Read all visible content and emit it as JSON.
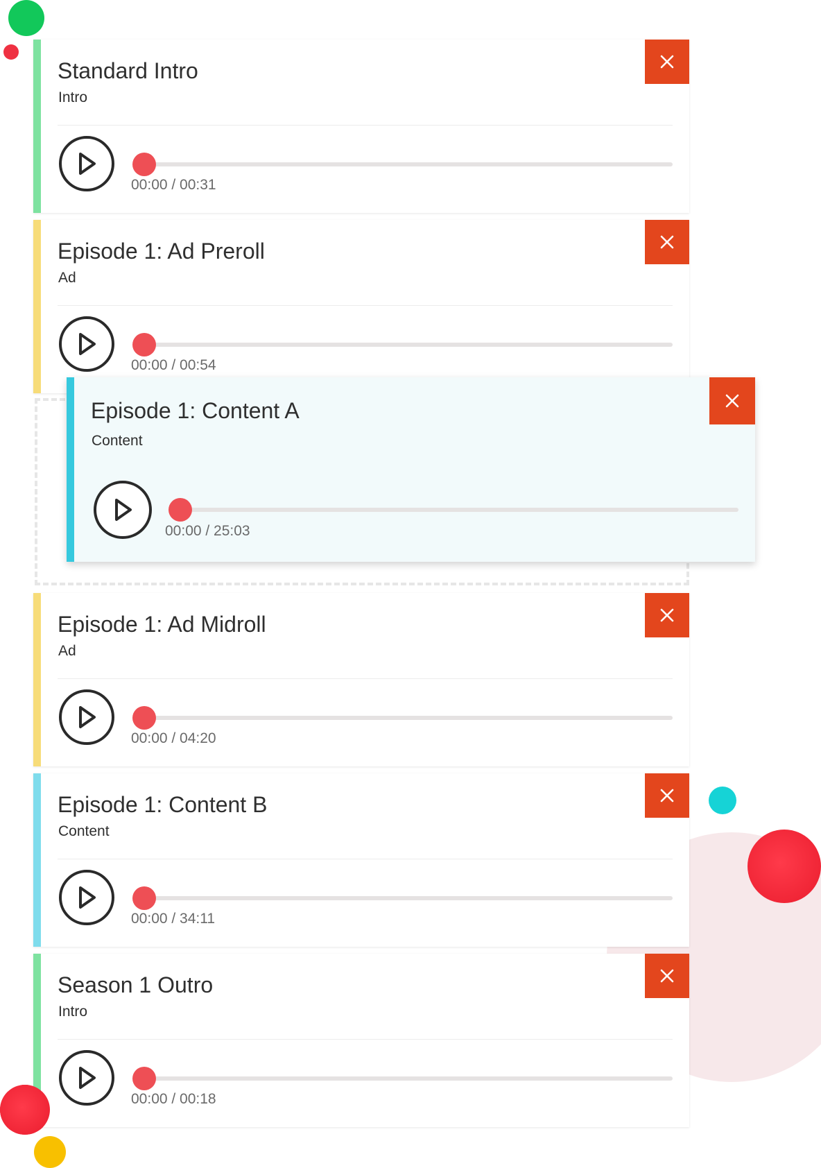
{
  "colors": {
    "intro": "#7ee2a0",
    "ad": "#f7dc79",
    "content": "#7fdcec",
    "close_button": "#e3461d",
    "progress_thumb": "#ee4f55"
  },
  "icons": {
    "close": "close-icon",
    "play": "play-icon"
  },
  "cards": [
    {
      "title": "Standard Intro",
      "type": "Intro",
      "time": "00:00 / 00:31",
      "progress": 0
    },
    {
      "title": "Episode 1: Ad Preroll",
      "type": "Ad",
      "time": "00:00 / 00:54",
      "progress": 0
    },
    {
      "title": "Episode 1: Content A",
      "type": "Content",
      "time": "00:00 / 25:03",
      "progress": 0
    },
    {
      "title": "Episode 1: Ad Midroll",
      "type": "Ad",
      "time": "00:00 / 04:20",
      "progress": 0
    },
    {
      "title": "Episode 1: Content B",
      "type": "Content",
      "time": "00:00 / 34:11",
      "progress": 0
    },
    {
      "title": "Season 1 Outro",
      "type": "Intro",
      "time": "00:00 / 00:18",
      "progress": 0
    }
  ]
}
